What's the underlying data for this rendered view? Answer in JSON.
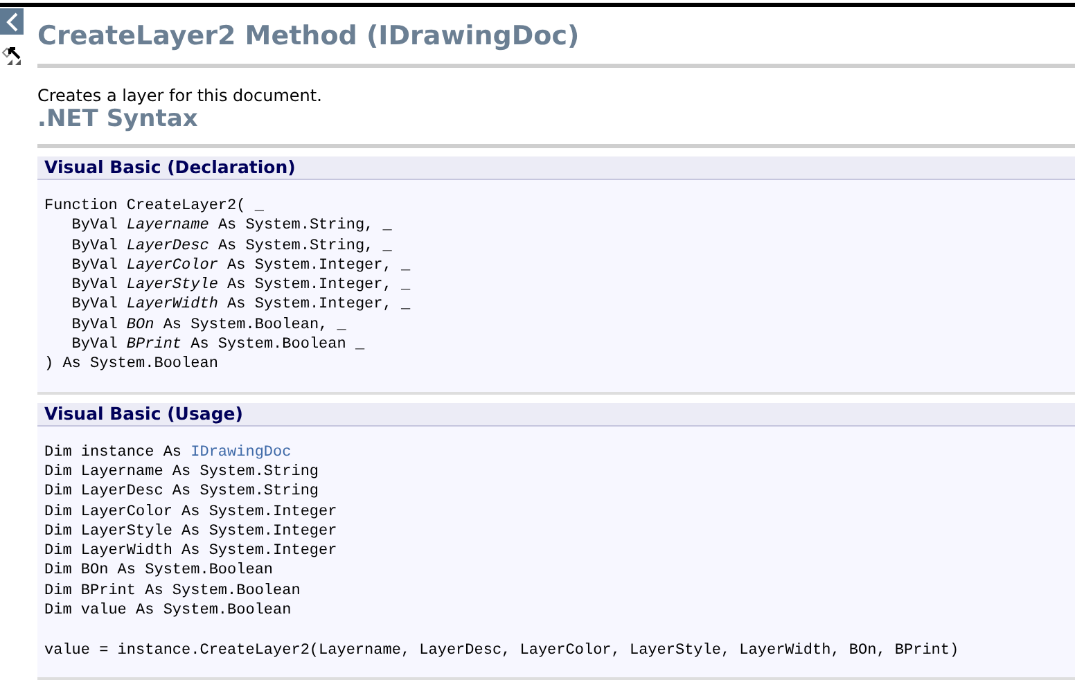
{
  "page": {
    "title": "CreateLayer2 Method (IDrawingDoc)",
    "description": "Creates a layer for this document.",
    "section_heading": ".NET Syntax"
  },
  "code_sections": [
    {
      "title": "Visual Basic (Declaration)",
      "lines": [
        {
          "text": "Function CreateLayer2( _"
        },
        {
          "text": "   ByVal *Layername* As System.String, _"
        },
        {
          "text": "   ByVal *LayerDesc* As System.String, _"
        },
        {
          "text": "   ByVal *LayerColor* As System.Integer, _"
        },
        {
          "text": "   ByVal *LayerStyle* As System.Integer, _"
        },
        {
          "text": "   ByVal *LayerWidth* As System.Integer, _"
        },
        {
          "text": "   ByVal *BOn* As System.Boolean, _"
        },
        {
          "text": "   ByVal *BPrint* As System.Boolean _"
        },
        {
          "text": ") As System.Boolean"
        }
      ]
    },
    {
      "title": "Visual Basic (Usage)",
      "lines": [
        {
          "text": "Dim instance As ",
          "link": "IDrawingDoc"
        },
        {
          "text": "Dim Layername As System.String"
        },
        {
          "text": "Dim LayerDesc As System.String"
        },
        {
          "text": "Dim LayerColor As System.Integer"
        },
        {
          "text": "Dim LayerStyle As System.Integer"
        },
        {
          "text": "Dim LayerWidth As System.Integer"
        },
        {
          "text": "Dim BOn As System.Boolean"
        },
        {
          "text": "Dim BPrint As System.Boolean"
        },
        {
          "text": "Dim value As System.Boolean"
        },
        {
          "gap_before": true,
          "text": "value = instance.CreateLayer2(Layername, LayerDesc, LayerColor, LayerStyle, LayerWidth, BOn, BPrint)"
        }
      ]
    }
  ]
}
